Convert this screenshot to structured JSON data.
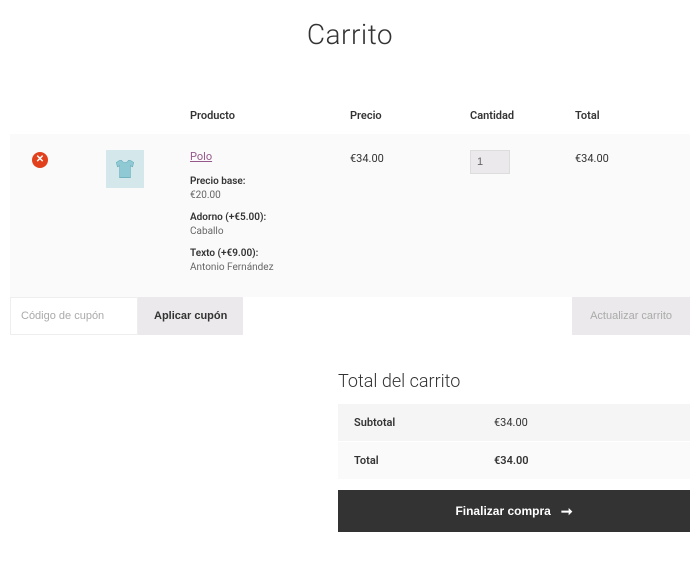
{
  "page": {
    "title": "Carrito"
  },
  "table": {
    "headers": {
      "product": "Producto",
      "price": "Precio",
      "quantity": "Cantidad",
      "total": "Total"
    }
  },
  "item": {
    "name": "Polo",
    "price": "€34.00",
    "quantity": "1",
    "line_total": "€34.00",
    "base_price_label": "Precio base:",
    "base_price_value": "€20.00",
    "addon1_label": "Adorno (+€5.00):",
    "addon1_value": "Caballo",
    "addon2_label": "Texto (+€9.00):",
    "addon2_value": "Antonio Fernández"
  },
  "coupon": {
    "placeholder": "Código de cupón",
    "apply_label": "Aplicar cupón"
  },
  "actions": {
    "update_label": "Actualizar carrito"
  },
  "totals": {
    "title": "Total del carrito",
    "subtotal_label": "Subtotal",
    "subtotal_value": "€34.00",
    "total_label": "Total",
    "total_value": "€34.00"
  },
  "checkout": {
    "label": "Finalizar compra"
  }
}
